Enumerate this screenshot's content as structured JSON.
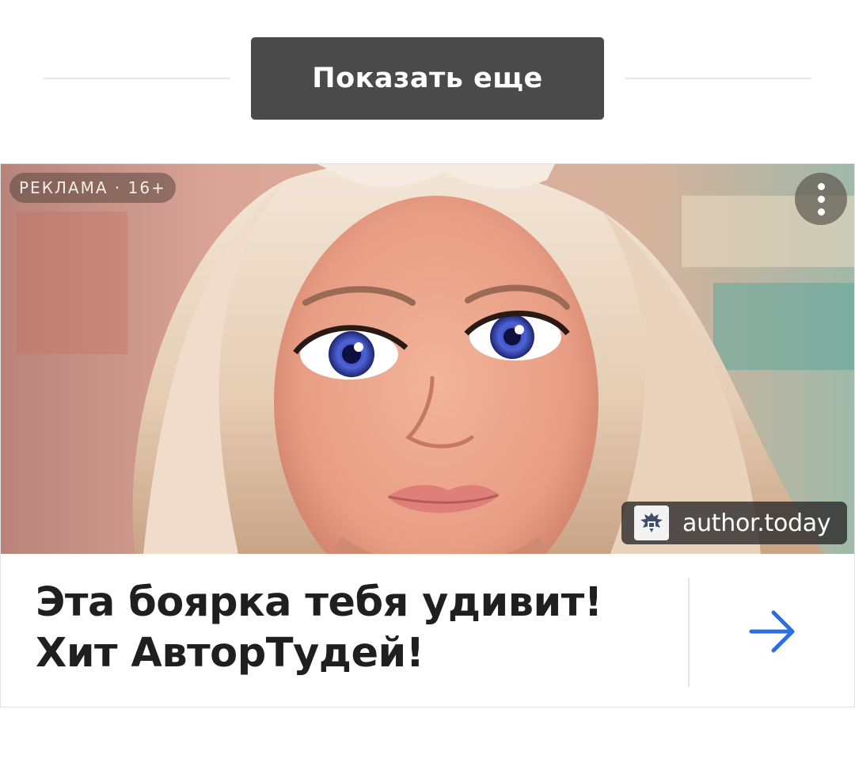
{
  "load_more": {
    "label": "Показать еще"
  },
  "ad": {
    "label": "РЕКЛАМА · 16+",
    "menu_icon": "more-vertical-icon",
    "source": {
      "name": "author.today",
      "logo_icon": "eagle-crest-icon"
    },
    "headline": "Эта боярка тебя удивит!\nХит АвторТудей!",
    "cta_icon": "arrow-right-icon",
    "accent_color": "#2a6ee0"
  }
}
